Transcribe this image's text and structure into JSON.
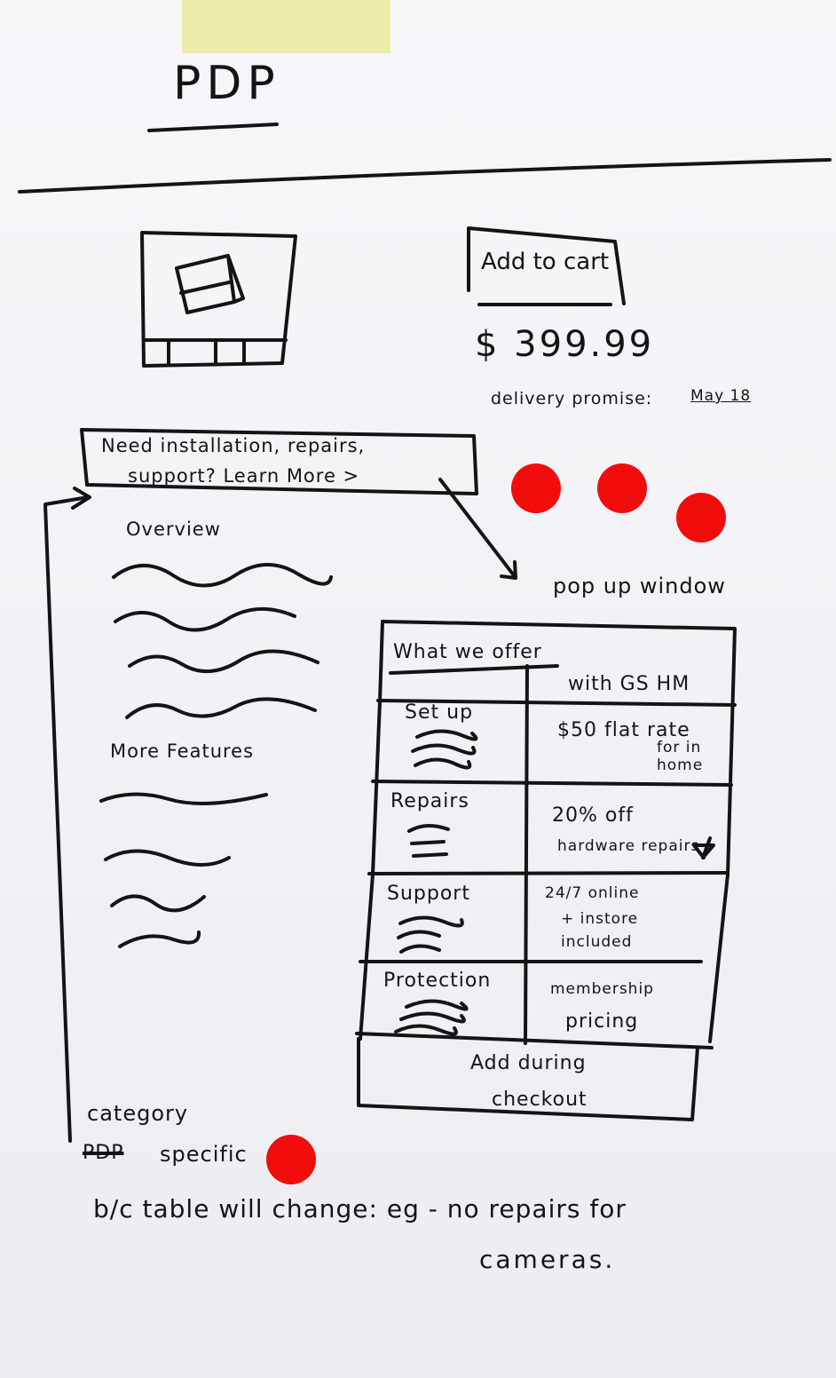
{
  "header": {
    "title": "PDP"
  },
  "product": {
    "add_to_cart": "Add to cart",
    "price": "$ 399.99",
    "delivery_label": "delivery promise:",
    "delivery_date": "May 18"
  },
  "services_banner": {
    "line1": "Need installation, repairs,",
    "line2": "support? Learn More >"
  },
  "content": {
    "overview_heading": "Overview",
    "more_features_heading": "More Features"
  },
  "popup": {
    "label": "pop up window",
    "heading": "What we offer",
    "column_heading": "with GS HM",
    "rows": [
      {
        "service": "Set up",
        "value_main": "$50 flat rate",
        "value_note": "for in home"
      },
      {
        "service": "Repairs",
        "value_main": "20% off",
        "value_note": "hardware repairs"
      },
      {
        "service": "Support",
        "value_main": "24/7 online",
        "value_note": "+ instore included"
      },
      {
        "service": "Protection",
        "value_main": "membership",
        "value_note": "pricing"
      }
    ],
    "footer_line1": "Add during",
    "footer_line2": "checkout"
  },
  "notes": {
    "category": "category",
    "struck": "PDP",
    "specific": "specific",
    "line3": "b/c table will change: eg - no repairs for",
    "line4": "cameras."
  },
  "colors": {
    "ink": "#141414",
    "vote_dot": "#f20d0d",
    "tape": "#e9eaa0"
  },
  "icons": [
    "product-image-placeholder",
    "arrow-icon",
    "star-icon"
  ]
}
